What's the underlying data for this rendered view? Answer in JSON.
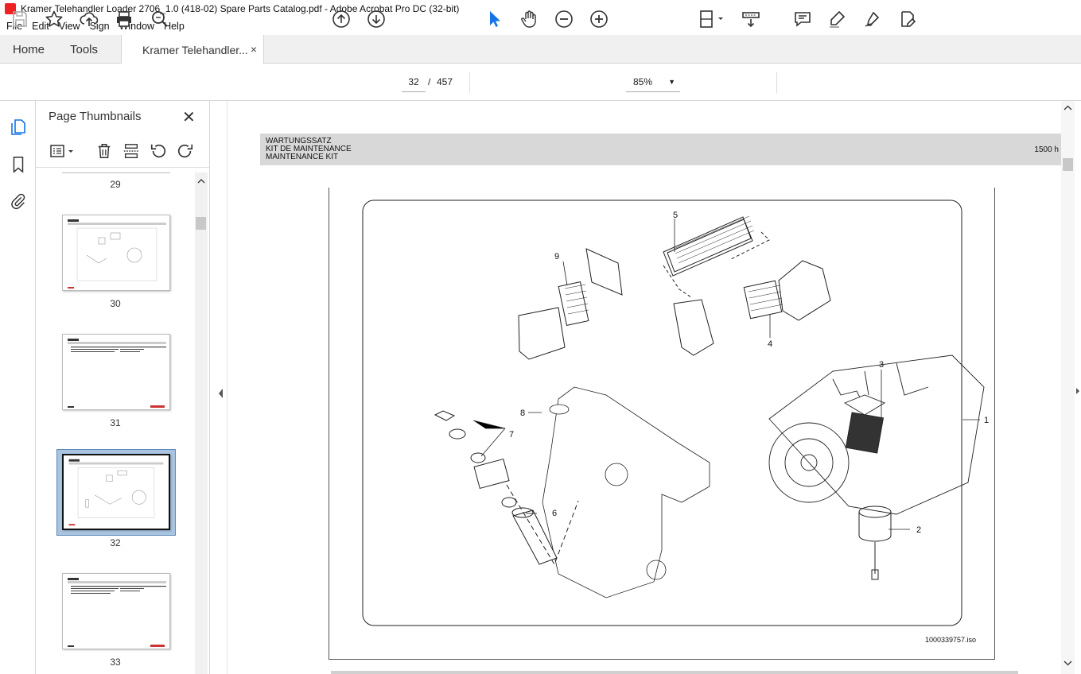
{
  "window": {
    "title": "Kramer Telehandler Loader 2706_1.0 (418-02) Spare Parts Catalog.pdf - Adobe Acrobat Pro DC (32-bit)"
  },
  "menu": [
    "File",
    "Edit",
    "View",
    "Sign",
    "Window",
    "Help"
  ],
  "tabs": {
    "home": "Home",
    "tools": "Tools",
    "document": "Kramer Telehandler...",
    "close": "×"
  },
  "toolbar": {
    "current_page": "32",
    "page_separator": "/",
    "total_pages": "457",
    "zoom": "85%"
  },
  "panel": {
    "title": "Page Thumbnails",
    "close": "✕",
    "thumbnails": [
      {
        "label": "29"
      },
      {
        "label": "30"
      },
      {
        "label": "31"
      },
      {
        "label": "32",
        "selected": true
      },
      {
        "label": "33"
      }
    ]
  },
  "document": {
    "header_lines": [
      "WARTUNGSSATZ",
      "KIT DE MAINTENANCE",
      "MAINTENANCE KIT"
    ],
    "header_right": "1500 h",
    "drawing_code": "1000339757.iso",
    "callouts": [
      "1",
      "2",
      "3",
      "4",
      "5",
      "6",
      "7",
      "8",
      "9"
    ]
  },
  "colors": {
    "accent_blue": "#1473e6",
    "selected_thumb": "#a8c4e0",
    "header_band": "#d8d8d8"
  },
  "icons": [
    "save-icon",
    "star-icon",
    "upload-icon",
    "print-icon",
    "search-icon",
    "arrow-up-icon",
    "arrow-down-icon",
    "select-arrow-icon",
    "hand-icon",
    "zoom-out-icon",
    "zoom-in-icon",
    "fit-page-icon",
    "scroll-mode-icon",
    "comment-icon",
    "highlight-icon",
    "sign-icon",
    "edit-pdf-icon"
  ]
}
